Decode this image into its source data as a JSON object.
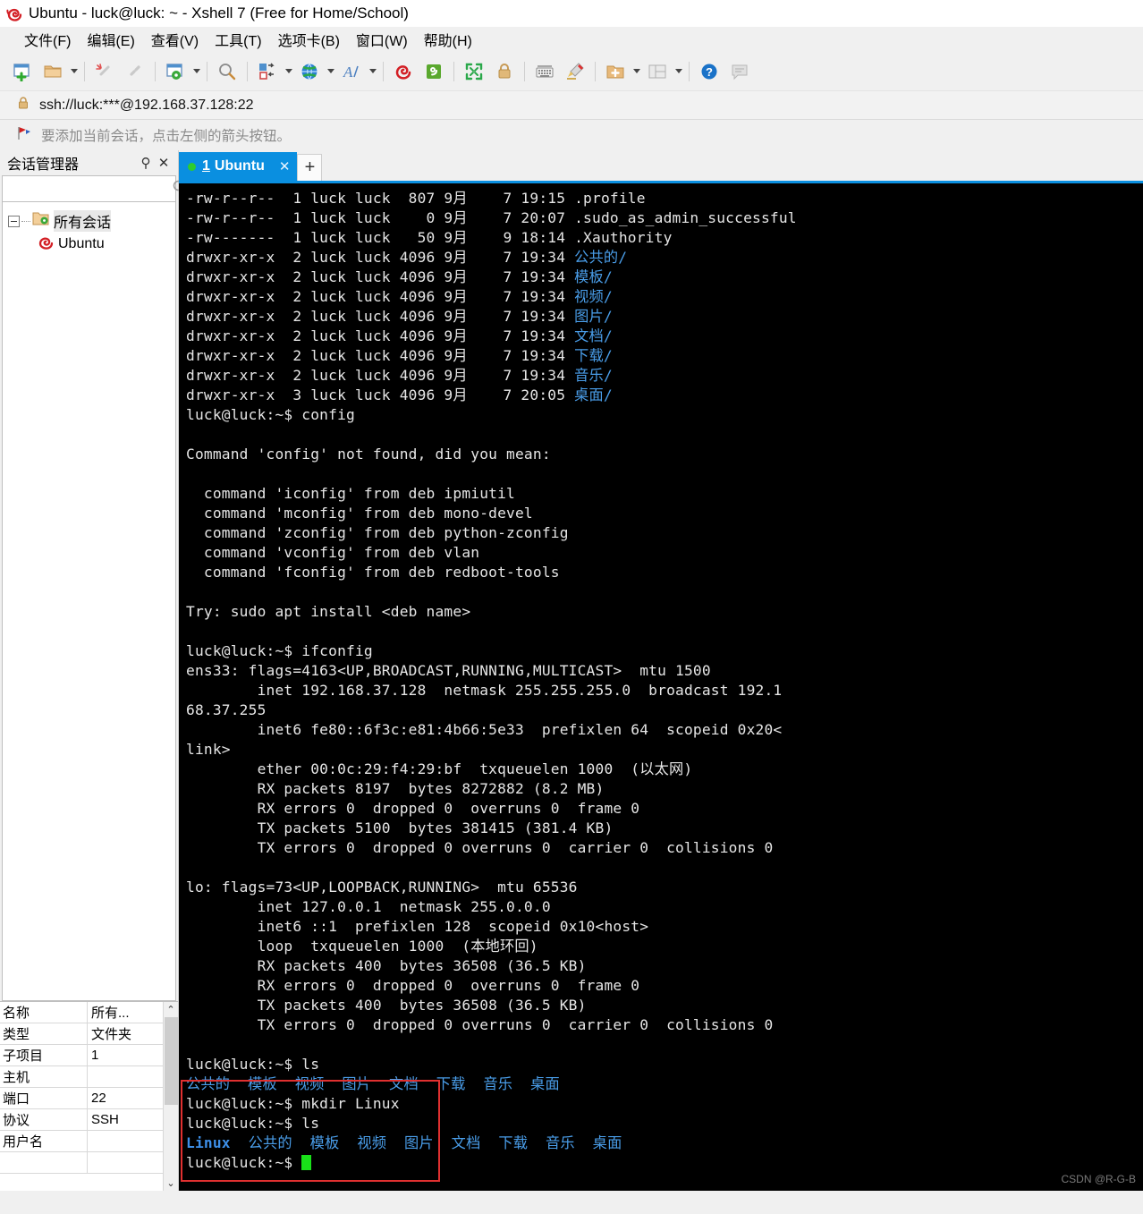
{
  "window": {
    "title": "Ubuntu - luck@luck: ~ - Xshell 7 (Free for Home/School)",
    "logo_icon": "xshell-snail-icon"
  },
  "menubar": [
    {
      "label": "文件(F)",
      "name": "menu-file"
    },
    {
      "label": "编辑(E)",
      "name": "menu-edit"
    },
    {
      "label": "查看(V)",
      "name": "menu-view"
    },
    {
      "label": "工具(T)",
      "name": "menu-tools"
    },
    {
      "label": "选项卡(B)",
      "name": "menu-tabs"
    },
    {
      "label": "窗口(W)",
      "name": "menu-window"
    },
    {
      "label": "帮助(H)",
      "name": "menu-help"
    }
  ],
  "toolbar": {
    "items": [
      {
        "name": "new-session-icon",
        "caret": false
      },
      {
        "name": "open-folder-icon",
        "caret": true
      },
      {
        "sep": true
      },
      {
        "name": "disconnect-icon",
        "caret": false
      },
      {
        "name": "reconnect-icon",
        "caret": false
      },
      {
        "sep": true
      },
      {
        "name": "session-properties-icon",
        "caret": true
      },
      {
        "sep": true
      },
      {
        "name": "find-icon",
        "caret": false
      },
      {
        "sep": true
      },
      {
        "name": "transfer-file-icon",
        "caret": true
      },
      {
        "name": "globe-icon",
        "caret": true
      },
      {
        "name": "font-icon",
        "caret": true
      },
      {
        "sep": true
      },
      {
        "name": "xshell-icon",
        "caret": false
      },
      {
        "name": "xftp-icon",
        "caret": false
      },
      {
        "sep": true
      },
      {
        "name": "fullscreen-icon",
        "caret": false
      },
      {
        "name": "lock-icon",
        "caret": false
      },
      {
        "sep": true
      },
      {
        "name": "keyboard-icon",
        "caret": false
      },
      {
        "name": "highlight-icon",
        "caret": false
      },
      {
        "sep": true
      },
      {
        "name": "new-folder-icon",
        "caret": true
      },
      {
        "name": "layout-icon",
        "caret": true
      },
      {
        "sep": true
      },
      {
        "name": "help-icon",
        "caret": false
      },
      {
        "name": "feedback-icon",
        "caret": false
      }
    ]
  },
  "address": {
    "lock_icon": "lock-icon",
    "url": "ssh://luck:***@192.168.37.128:22"
  },
  "notice": {
    "flag_icon": "red-flag-icon",
    "text": "要添加当前会话，点击左侧的箭头按钮。"
  },
  "sidebar": {
    "title": "会话管理器",
    "pin_label": "⚲",
    "close_label": "✕",
    "search": {
      "value": "",
      "placeholder": "",
      "icon": "search-icon"
    },
    "tree": {
      "root": {
        "label": "所有会话",
        "icon": "folder-settings-icon"
      },
      "children": [
        {
          "label": "Ubuntu",
          "icon": "xshell-snail-icon"
        }
      ]
    }
  },
  "properties": {
    "rows": [
      {
        "key": "名称",
        "value": "所有..."
      },
      {
        "key": "类型",
        "value": "文件夹"
      },
      {
        "key": "子项目",
        "value": "1"
      },
      {
        "key": "主机",
        "value": ""
      },
      {
        "key": "端口",
        "value": "22"
      },
      {
        "key": "协议",
        "value": "SSH"
      },
      {
        "key": "用户名",
        "value": ""
      },
      {
        "key": "",
        "value": ""
      }
    ],
    "scroll_up": "⌃",
    "scroll_down": "⌄"
  },
  "tabs": {
    "active": {
      "number": "1",
      "label": "Ubuntu",
      "close_label": "✕",
      "status_icon": "green-dot-icon"
    },
    "add_label": "+"
  },
  "terminal": {
    "colors": {
      "background": "#000000",
      "foreground": "#e6e6e6",
      "directory": "#4a9eea",
      "directory_bold": "#3d8fe8",
      "cursor": "#19e019",
      "annotation": "#e03030"
    },
    "lines": [
      {
        "text": "-rw-r--r--  1 luck luck  807 9月    7 19:15 .profile"
      },
      {
        "text": "-rw-r--r--  1 luck luck    0 9月    7 20:07 .sudo_as_admin_successful"
      },
      {
        "text": "-rw-------  1 luck luck   50 9月    9 18:14 .Xauthority"
      },
      {
        "text": "drwxr-xr-x  2 luck luck 4096 9月    7 19:34 ",
        "dir": "公共的/"
      },
      {
        "text": "drwxr-xr-x  2 luck luck 4096 9月    7 19:34 ",
        "dir": "模板/"
      },
      {
        "text": "drwxr-xr-x  2 luck luck 4096 9月    7 19:34 ",
        "dir": "视频/"
      },
      {
        "text": "drwxr-xr-x  2 luck luck 4096 9月    7 19:34 ",
        "dir": "图片/"
      },
      {
        "text": "drwxr-xr-x  2 luck luck 4096 9月    7 19:34 ",
        "dir": "文档/"
      },
      {
        "text": "drwxr-xr-x  2 luck luck 4096 9月    7 19:34 ",
        "dir": "下载/"
      },
      {
        "text": "drwxr-xr-x  2 luck luck 4096 9月    7 19:34 ",
        "dir": "音乐/"
      },
      {
        "text": "drwxr-xr-x  3 luck luck 4096 9月    7 20:05 ",
        "dir": "桌面/"
      },
      {
        "text": "luck@luck:~$ config"
      },
      {
        "text": ""
      },
      {
        "text": "Command 'config' not found, did you mean:"
      },
      {
        "text": ""
      },
      {
        "text": "  command 'iconfig' from deb ipmiutil"
      },
      {
        "text": "  command 'mconfig' from deb mono-devel"
      },
      {
        "text": "  command 'zconfig' from deb python-zconfig"
      },
      {
        "text": "  command 'vconfig' from deb vlan"
      },
      {
        "text": "  command 'fconfig' from deb redboot-tools"
      },
      {
        "text": ""
      },
      {
        "text": "Try: sudo apt install <deb name>"
      },
      {
        "text": ""
      },
      {
        "text": "luck@luck:~$ ifconfig"
      },
      {
        "text": "ens33: flags=4163<UP,BROADCAST,RUNNING,MULTICAST>  mtu 1500"
      },
      {
        "text": "        inet 192.168.37.128  netmask 255.255.255.0  broadcast 192.1"
      },
      {
        "text": "68.37.255"
      },
      {
        "text": "        inet6 fe80::6f3c:e81:4b66:5e33  prefixlen 64  scopeid 0x20<"
      },
      {
        "text": "link>"
      },
      {
        "text": "        ether 00:0c:29:f4:29:bf  txqueuelen 1000  (以太网)"
      },
      {
        "text": "        RX packets 8197  bytes 8272882 (8.2 MB)"
      },
      {
        "text": "        RX errors 0  dropped 0  overruns 0  frame 0"
      },
      {
        "text": "        TX packets 5100  bytes 381415 (381.4 KB)"
      },
      {
        "text": "        TX errors 0  dropped 0 overruns 0  carrier 0  collisions 0"
      },
      {
        "text": ""
      },
      {
        "text": "lo: flags=73<UP,LOOPBACK,RUNNING>  mtu 65536"
      },
      {
        "text": "        inet 127.0.0.1  netmask 255.0.0.0"
      },
      {
        "text": "        inet6 ::1  prefixlen 128  scopeid 0x10<host>"
      },
      {
        "text": "        loop  txqueuelen 1000  (本地环回)"
      },
      {
        "text": "        RX packets 400  bytes 36508 (36.5 KB)"
      },
      {
        "text": "        RX errors 0  dropped 0  overruns 0  frame 0"
      },
      {
        "text": "        TX packets 400  bytes 36508 (36.5 KB)"
      },
      {
        "text": "        TX errors 0  dropped 0 overruns 0  carrier 0  collisions 0"
      },
      {
        "text": ""
      },
      {
        "text": "luck@luck:~$ ls"
      },
      {
        "dir": "公共的  模板  视频  图片  文档  下载  音乐  桌面"
      },
      {
        "text": "luck@luck:~$ mkdir Linux"
      },
      {
        "text": "luck@luck:~$ ls"
      },
      {
        "dirb": "Linux  ",
        "dir": "公共的  模板  视频  图片  文档  下载  音乐  桌面"
      },
      {
        "text": "luck@luck:~$ ",
        "cursor": true
      }
    ]
  },
  "watermark": {
    "text": "CSDN @R-G-B"
  }
}
